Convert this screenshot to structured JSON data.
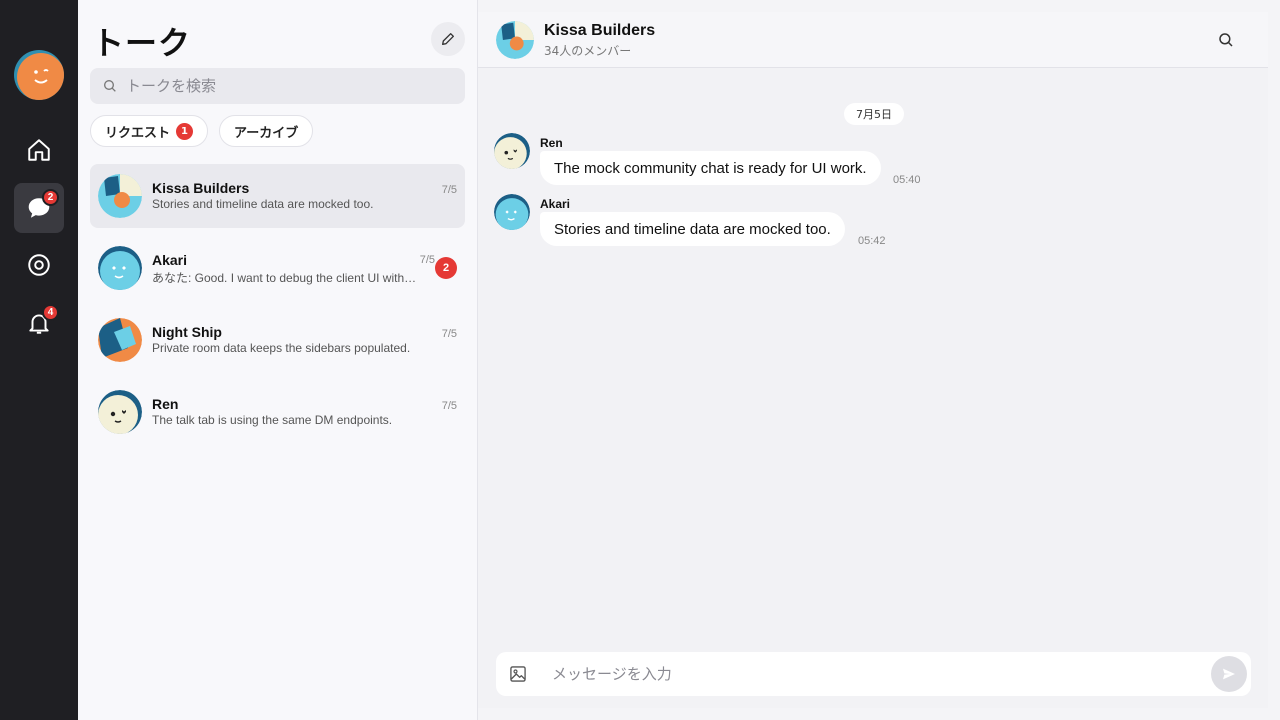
{
  "rail": {
    "items": [
      {
        "icon": "home-icon",
        "badge": ""
      },
      {
        "icon": "chat-bubble-icon",
        "badge": "2"
      },
      {
        "icon": "target-icon",
        "badge": ""
      },
      {
        "icon": "bell-icon",
        "badge": "4"
      }
    ]
  },
  "list": {
    "title": "トーク",
    "search_placeholder": "トークを検索",
    "chips": [
      {
        "label": "リクエスト",
        "badge": "1"
      },
      {
        "label": "アーカイブ"
      }
    ],
    "conversations": [
      {
        "name": "Kissa Builders",
        "preview": "Stories and timeline data are mocked too.",
        "date": "7/5",
        "badge": ""
      },
      {
        "name": "Akari",
        "preview": "あなた: Good. I want to debug the client UI without mocking every request by hand.",
        "date": "7/5",
        "badge": "2"
      },
      {
        "name": "Night Ship",
        "preview": "Private room data keeps the sidebars populated.",
        "date": "7/5",
        "badge": ""
      },
      {
        "name": "Ren",
        "preview": "The talk tab is using the same DM endpoints.",
        "date": "7/5",
        "badge": ""
      }
    ]
  },
  "chat": {
    "title": "Kissa Builders",
    "subtitle": "34人のメンバー",
    "day_label": "7月5日",
    "messages": [
      {
        "sender": "Ren",
        "text": "The mock community chat is ready for UI work.",
        "time": "05:40"
      },
      {
        "sender": "Akari",
        "text": "Stories and timeline data are mocked too.",
        "time": "05:42"
      }
    ],
    "composer_placeholder": "メッセージを入力"
  },
  "colors": {
    "rail_bg": "#1f1f23",
    "badge_red": "#e53935",
    "avatar_orange": "#f08a45",
    "avatar_blue": "#2f8fb0",
    "avatar_cyan": "#6ccfe6"
  }
}
